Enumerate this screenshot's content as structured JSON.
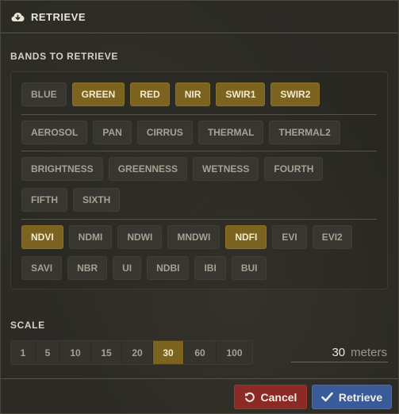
{
  "header": {
    "title": "RETRIEVE",
    "icon": "cloud-download-icon"
  },
  "bands": {
    "label": "BANDS TO RETRIEVE",
    "groups": [
      {
        "items": [
          {
            "label": "BLUE",
            "selected": false
          },
          {
            "label": "GREEN",
            "selected": true
          },
          {
            "label": "RED",
            "selected": true
          },
          {
            "label": "NIR",
            "selected": true
          },
          {
            "label": "SWIR1",
            "selected": true
          },
          {
            "label": "SWIR2",
            "selected": true
          }
        ]
      },
      {
        "items": [
          {
            "label": "AEROSOL",
            "selected": false
          },
          {
            "label": "PAN",
            "selected": false
          },
          {
            "label": "CIRRUS",
            "selected": false
          },
          {
            "label": "THERMAL",
            "selected": false
          },
          {
            "label": "THERMAL2",
            "selected": false
          }
        ]
      },
      {
        "items": [
          {
            "label": "BRIGHTNESS",
            "selected": false
          },
          {
            "label": "GREENNESS",
            "selected": false
          },
          {
            "label": "WETNESS",
            "selected": false
          },
          {
            "label": "FOURTH",
            "selected": false
          },
          {
            "label": "FIFTH",
            "selected": false
          },
          {
            "label": "SIXTH",
            "selected": false
          }
        ]
      },
      {
        "items": [
          {
            "label": "NDVI",
            "selected": true
          },
          {
            "label": "NDMI",
            "selected": false
          },
          {
            "label": "NDWI",
            "selected": false
          },
          {
            "label": "MNDWI",
            "selected": false
          },
          {
            "label": "NDFI",
            "selected": true
          },
          {
            "label": "EVI",
            "selected": false
          },
          {
            "label": "EVI2",
            "selected": false
          },
          {
            "label": "SAVI",
            "selected": false
          },
          {
            "label": "NBR",
            "selected": false
          },
          {
            "label": "UI",
            "selected": false
          },
          {
            "label": "NDBI",
            "selected": false
          },
          {
            "label": "IBI",
            "selected": false
          },
          {
            "label": "BUI",
            "selected": false
          }
        ]
      }
    ]
  },
  "scale": {
    "label": "SCALE",
    "options": [
      "1",
      "5",
      "10",
      "15",
      "20",
      "30",
      "60",
      "100"
    ],
    "selected": "30",
    "value": "30",
    "unit": "meters"
  },
  "actions": {
    "cancel_label": "Cancel",
    "retrieve_label": "Retrieve"
  },
  "colors": {
    "selected": "#7c6420",
    "cancel": "#8c2a26",
    "retrieve": "#3a5b99"
  }
}
